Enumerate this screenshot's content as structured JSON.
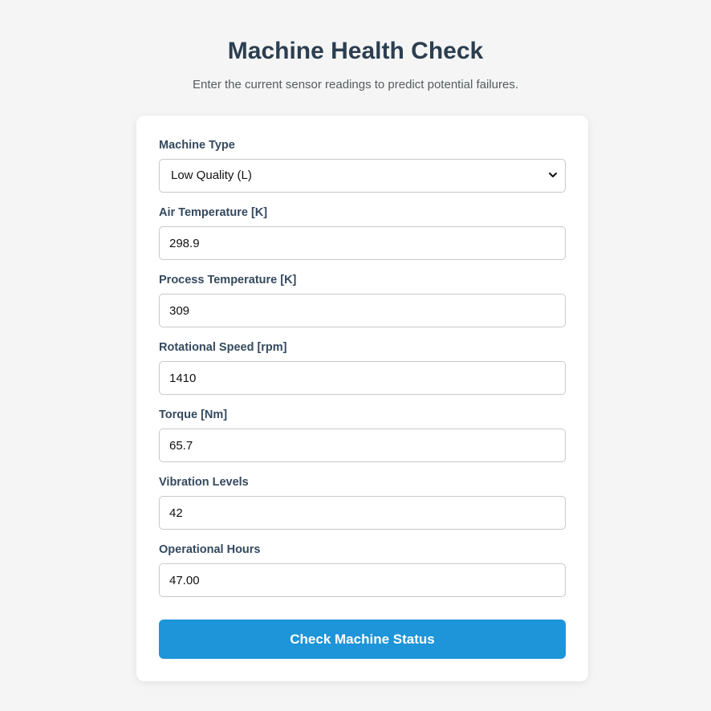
{
  "header": {
    "title": "Machine Health Check",
    "subtitle": "Enter the current sensor readings to predict potential failures."
  },
  "form": {
    "machine_type": {
      "label": "Machine Type",
      "selected": "Low Quality (L)"
    },
    "air_temperature": {
      "label": "Air Temperature [K]",
      "value": "298.9"
    },
    "process_temperature": {
      "label": "Process Temperature [K]",
      "value": "309"
    },
    "rotational_speed": {
      "label": "Rotational Speed [rpm]",
      "value": "1410"
    },
    "torque": {
      "label": "Torque [Nm]",
      "value": "65.7"
    },
    "vibration_levels": {
      "label": "Vibration Levels",
      "value": "42"
    },
    "operational_hours": {
      "label": "Operational Hours",
      "value": "47.00"
    },
    "submit_label": "Check Machine Status"
  },
  "colors": {
    "background": "#f4f5f4",
    "card": "#ffffff",
    "heading": "#2c3e50",
    "accent_button": "#1e95d8"
  }
}
